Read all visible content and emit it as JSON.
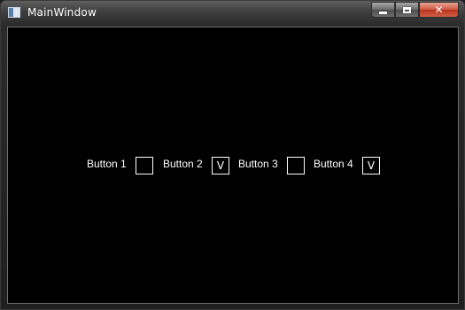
{
  "window": {
    "title": "MainWindow",
    "caption_buttons": [
      "minimize",
      "maximize",
      "close"
    ]
  },
  "buttons": [
    {
      "label": "Button 1",
      "mark": ""
    },
    {
      "label": "Button 2",
      "mark": "V"
    },
    {
      "label": "Button 3",
      "mark": ""
    },
    {
      "label": "Button 4",
      "mark": "V"
    }
  ],
  "colors": {
    "client_background": "#000000",
    "text": "#ffffff",
    "close_button": "#c7432b"
  }
}
